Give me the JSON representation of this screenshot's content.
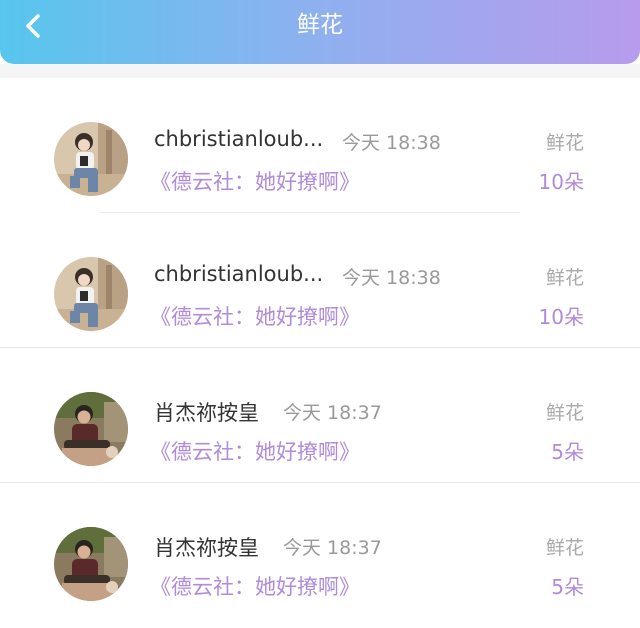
{
  "header": {
    "title": "鲜花"
  },
  "records": [
    {
      "name": "chbristianloub...",
      "time": "今天 18:38",
      "book": "《德云社：她好撩啊》",
      "gift": "鲜花",
      "count": "10朵"
    },
    {
      "name": "chbristianloub...",
      "time": "今天 18:38",
      "book": "《德云社：她好撩啊》",
      "gift": "鲜花",
      "count": "10朵"
    },
    {
      "name": "肖杰祢按皇",
      "time": "今天 18:37",
      "book": "《德云社：她好撩啊》",
      "gift": "鲜花",
      "count": "5朵"
    },
    {
      "name": "肖杰祢按皇",
      "time": "今天 18:37",
      "book": "《德云社：她好撩啊》",
      "gift": "鲜花",
      "count": "5朵"
    }
  ]
}
